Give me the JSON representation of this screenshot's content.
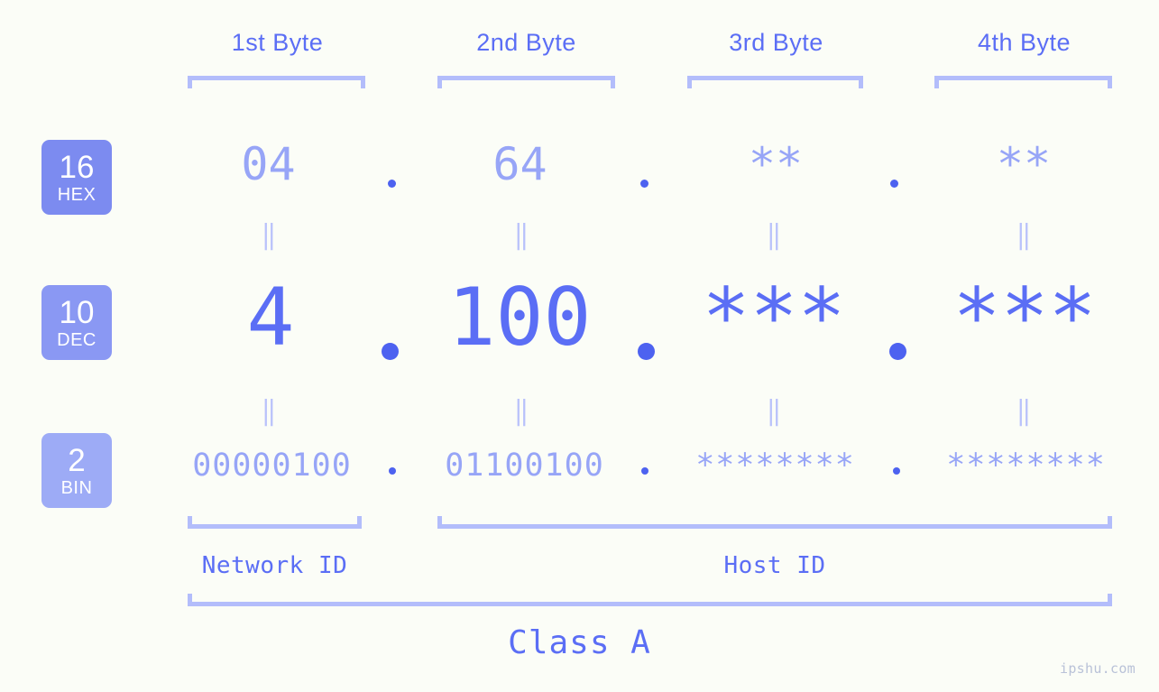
{
  "watermark": "ipshu.com",
  "byte_headers": [
    {
      "label": "1st Byte"
    },
    {
      "label": "2nd Byte"
    },
    {
      "label": "3rd Byte"
    },
    {
      "label": "4th Byte"
    }
  ],
  "bases": [
    {
      "num": "16",
      "name": "HEX",
      "color": "#7c8bf0"
    },
    {
      "num": "10",
      "name": "DEC",
      "color": "#8a98f3"
    },
    {
      "num": "2",
      "name": "BIN",
      "color": "#9dabf6"
    }
  ],
  "rows": {
    "hex": {
      "base_num": "16",
      "base_name": "HEX",
      "values": [
        "04",
        "64",
        "**",
        "**"
      ]
    },
    "dec": {
      "base_num": "10",
      "base_name": "DEC",
      "values": [
        "4",
        "100",
        "***",
        "***"
      ]
    },
    "bin": {
      "base_num": "2",
      "base_name": "BIN",
      "values": [
        "00000100",
        "01100100",
        "********",
        "********"
      ]
    }
  },
  "separators": {
    "dot": ".",
    "equals": "‖"
  },
  "id_sections": [
    {
      "label": "Network ID"
    },
    {
      "label": "Host ID"
    }
  ],
  "class_label": "Class A",
  "colors": {
    "background": "#fbfdf7",
    "accent_strong": "#5b6ef5",
    "accent_light": "#97a5f7",
    "bracket": "#b3bdfb",
    "equals": "#b9c2fb",
    "watermark": "#b9c2d8"
  }
}
